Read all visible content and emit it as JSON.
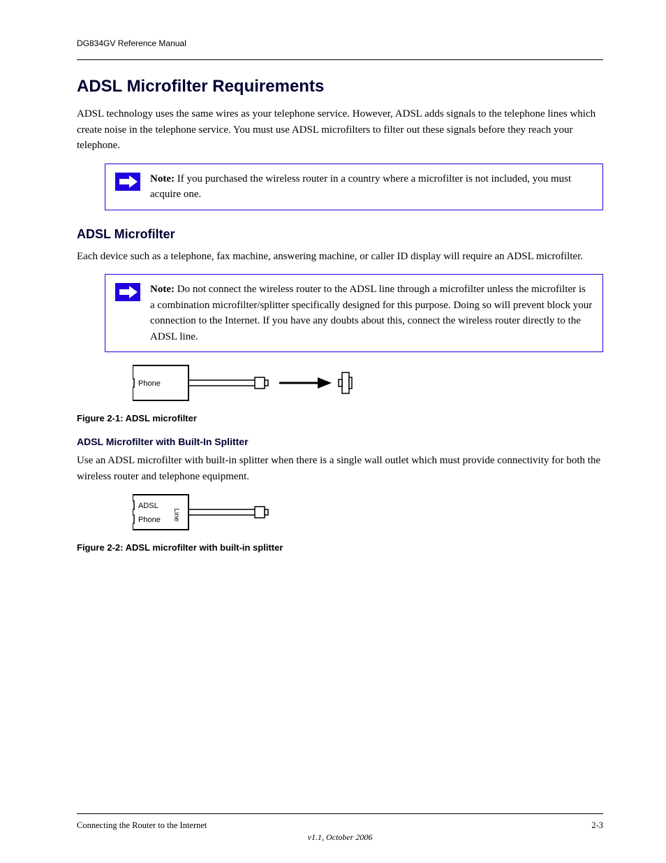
{
  "header": {
    "left": "DG834GV Reference Manual",
    "right": ""
  },
  "section_heading": "ADSL Microfilter Requirements",
  "para1": "ADSL technology uses the same wires as your telephone service. However, ADSL adds signals to the telephone lines which create noise in the telephone service. You must use ADSL microfilters to filter out these signals before they reach your telephone.",
  "note1_label": "Note:",
  "note1_text": " If you purchased the wireless router in a country where a microfilter is not included, you must acquire one.",
  "sub_heading": "ADSL Microfilter",
  "para2": "Each device such as a telephone, fax machine, answering machine, or caller ID display will require an ADSL microfilter.",
  "note2_label": "Note:",
  "note2_text": " Do not connect the wireless router to the ADSL line through a microfilter unless the microfilter is a combination microfilter/splitter specifically designed for this purpose. Doing so will prevent block your connection to the Internet. If you have any doubts about this, connect the wireless router directly to the ADSL line.",
  "fig1_caption": "Figure 2-1: ADSL microfilter",
  "minor_heading": "ADSL Microfilter with Built-In Splitter",
  "para3": "Use an ADSL microfilter with built-in splitter when there is a single wall outlet which must provide connectivity for both the wireless router and telephone equipment.",
  "fig2_caption": "Figure 2-2: ADSL microfilter with built-in splitter",
  "filter_labels": {
    "phone": "Phone",
    "adsl": "ADSL",
    "line": "Line"
  },
  "footer": {
    "left": "Connecting the Router to the Internet",
    "right": "2-3",
    "version": "v1.1, October 2006"
  }
}
